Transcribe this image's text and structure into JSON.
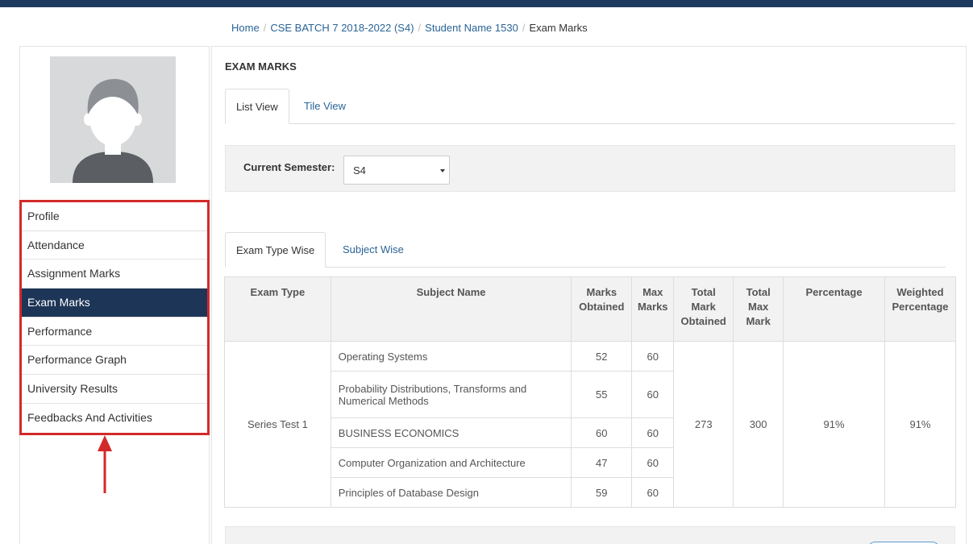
{
  "breadcrumb": {
    "home": "Home",
    "batch": "CSE BATCH 7 2018-2022 (S4)",
    "student": "Student Name 1530",
    "current": "Exam Marks",
    "separator": "/"
  },
  "sidebar": {
    "items": [
      {
        "label": "Profile"
      },
      {
        "label": "Attendance"
      },
      {
        "label": "Assignment Marks"
      },
      {
        "label": "Exam Marks"
      },
      {
        "label": "Performance"
      },
      {
        "label": "Performance Graph"
      },
      {
        "label": "University Results"
      },
      {
        "label": "Feedbacks And Activities"
      }
    ],
    "active_index": 3
  },
  "main": {
    "title": "EXAM MARKS",
    "view_tabs": [
      {
        "label": "List View"
      },
      {
        "label": "Tile View"
      }
    ],
    "semester": {
      "label": "Current Semester:",
      "selected": "S4"
    },
    "sub_tabs": [
      {
        "label": "Exam Type Wise"
      },
      {
        "label": "Subject Wise"
      }
    ]
  },
  "table": {
    "headers": {
      "exam_type": "Exam Type",
      "subject": "Subject Name",
      "marks_obtained": [
        "Marks",
        "Obtained"
      ],
      "max_marks": [
        "Max",
        "Marks"
      ],
      "total_obtained": [
        "Total",
        "Mark",
        "Obtained"
      ],
      "total_max": [
        "Total",
        "Max",
        "Mark"
      ],
      "percentage": "Percentage",
      "weighted": [
        "Weighted",
        "Percentage"
      ]
    },
    "exam_type": "Series Test 1",
    "rows": [
      {
        "subject": "Operating Systems",
        "obtained": "52",
        "max": "60"
      },
      {
        "subject": "Probability Distributions, Transforms and Numerical Methods",
        "obtained": "55",
        "max": "60"
      },
      {
        "subject": "BUSINESS ECONOMICS",
        "obtained": "60",
        "max": "60"
      },
      {
        "subject": "Computer Organization and Architecture",
        "obtained": "47",
        "max": "60"
      },
      {
        "subject": "Principles of Database Design",
        "obtained": "59",
        "max": "60"
      }
    ],
    "total_obtained": "273",
    "total_max": "300",
    "percentage": "91%",
    "weighted_percentage": "91%"
  },
  "colors": {
    "topbar": "#1e3a5f",
    "active_menu": "#1d3557",
    "highlight_red": "#d22a2a",
    "link_blue": "#2a6496"
  }
}
